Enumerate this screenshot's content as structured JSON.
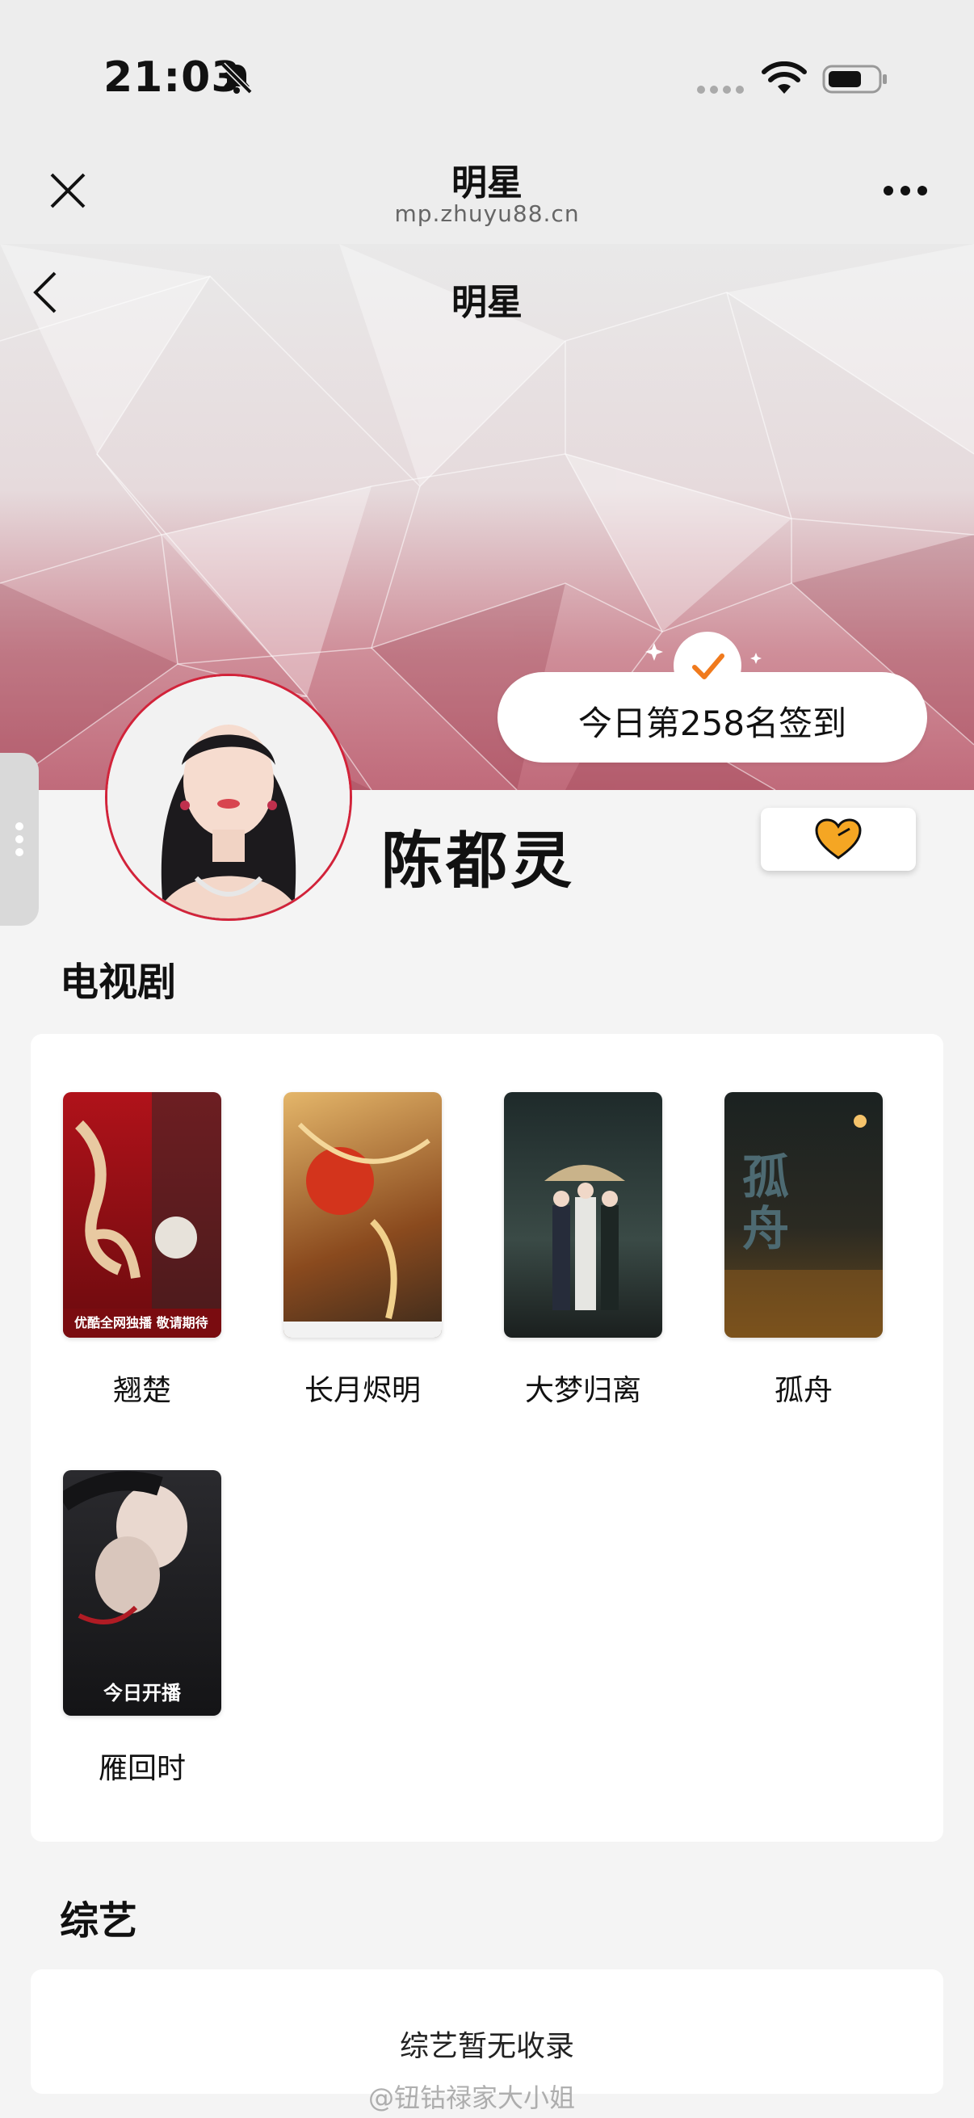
{
  "status_bar": {
    "time": "21:03"
  },
  "mini_program": {
    "title": "明星",
    "url": "mp.zhuyu88.cn"
  },
  "header": {
    "title": "明星"
  },
  "checkin": {
    "text": "今日第258名签到"
  },
  "star": {
    "name": "陈都灵"
  },
  "tv_section": {
    "title": "电视剧",
    "items": [
      {
        "name": "翘楚",
        "poster_text": "优酷全网独播 敬请期待"
      },
      {
        "name": "长月烬明",
        "poster_text": ""
      },
      {
        "name": "大梦归离",
        "poster_text": ""
      },
      {
        "name": "孤舟",
        "poster_text": "孤舟"
      },
      {
        "name": "雁回时",
        "poster_text": "今日开播"
      }
    ]
  },
  "variety_section": {
    "title": "综艺",
    "empty_text": "综艺暂无收录"
  },
  "watermark": "@钮钴禄家大小姐",
  "colors": {
    "accent_red": "#d2233a",
    "heart_orange": "#f5a623",
    "check_orange": "#f07a1d"
  }
}
